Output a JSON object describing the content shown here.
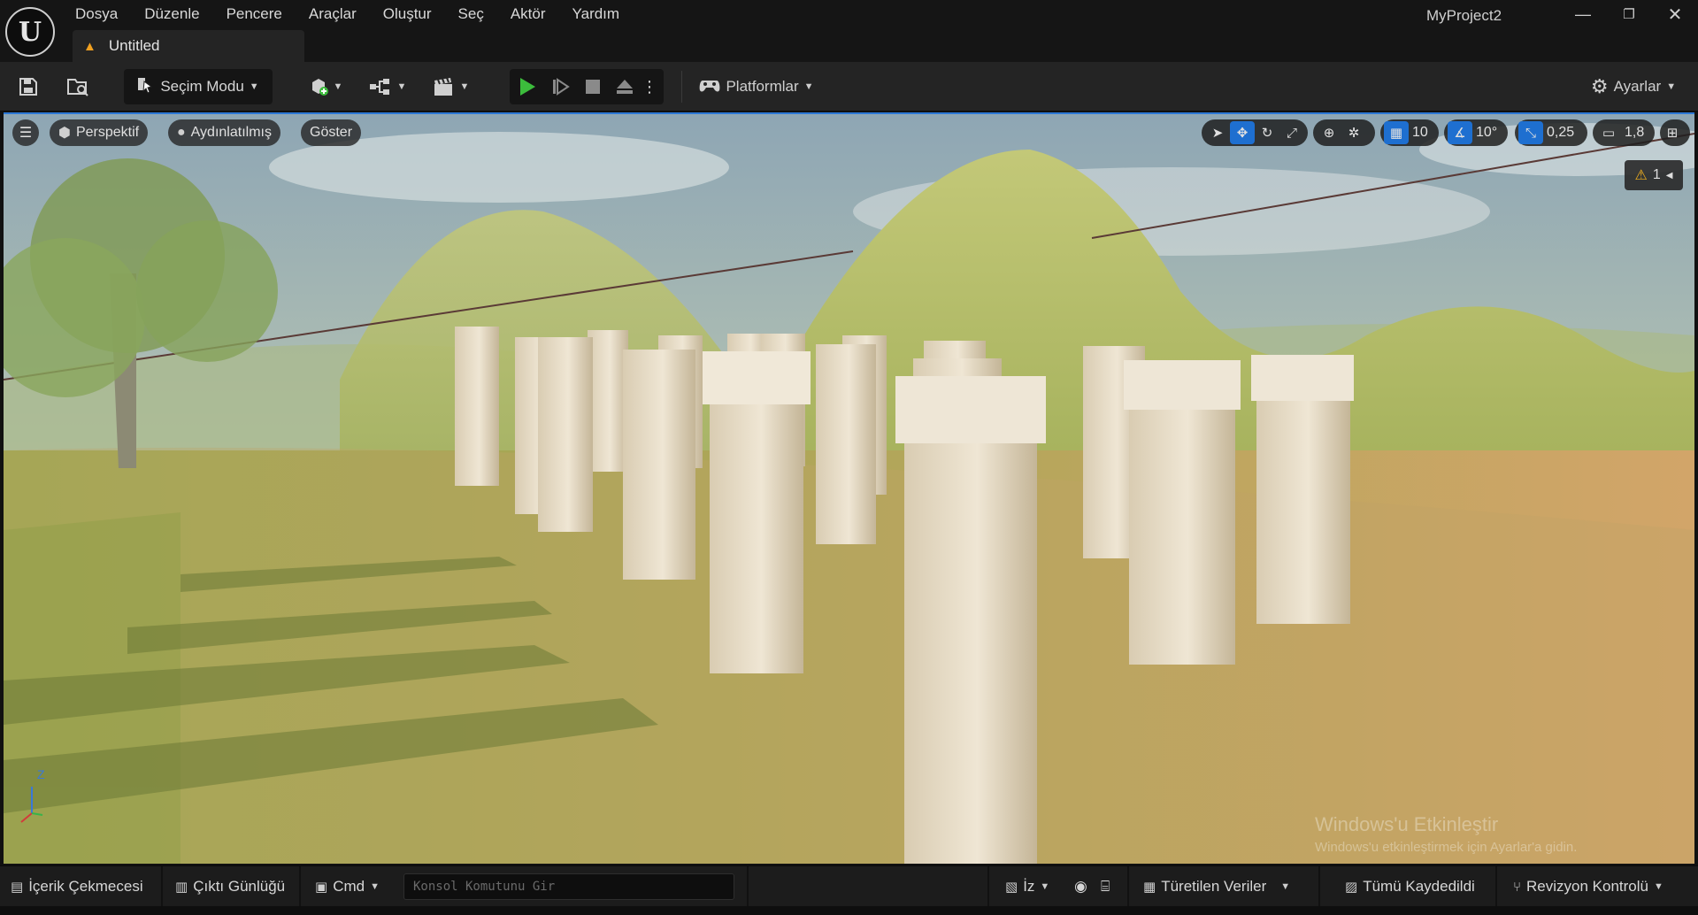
{
  "menu": {
    "items": [
      "Dosya",
      "Düzenle",
      "Pencere",
      "Araçlar",
      "Oluştur",
      "Seç",
      "Aktör",
      "Yardım"
    ]
  },
  "tab": {
    "label": "Untitled"
  },
  "project": {
    "name": "MyProject2"
  },
  "toolbar": {
    "mode_label": "Seçim Modu",
    "platforms_label": "Platformlar",
    "settings_label": "Ayarlar"
  },
  "viewport": {
    "perspective_label": "Perspektif",
    "lit_label": "Aydınlatılmış",
    "show_label": "Göster",
    "grid_snap": "10",
    "rotation_snap": "10°",
    "scale_snap": "0,25",
    "camera_speed": "1,8",
    "warning_count": "1",
    "axis_label": "Z"
  },
  "watermark": {
    "title": "Windows'u Etkinleştir",
    "subtitle": "Windows'u etkinleştirmek için Ayarlar'a gidin."
  },
  "statusbar": {
    "content_drawer": "İçerik Çekmecesi",
    "output_log": "Çıktı Günlüğü",
    "cmd_label": "Cmd",
    "console_placeholder": "Konsol Komutunu Gir",
    "trace_label": "İz",
    "derived_data": "Türetilen Veriler",
    "all_saved": "Tümü Kaydedildi",
    "revision_control": "Revizyon Kontrolü"
  },
  "colors": {
    "accent": "#1e6fd0",
    "play_green": "#3cbc3c",
    "warning": "#f2b01e"
  }
}
